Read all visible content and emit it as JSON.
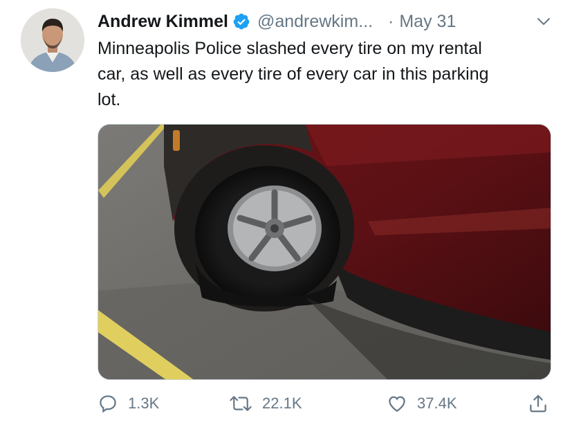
{
  "tweet": {
    "author": {
      "name": "Andrew Kimmel",
      "handle": "@andrewkim...",
      "verified": true,
      "avatar_icon": "profile-photo"
    },
    "separator": "·",
    "date": "May 31",
    "text_lines": [
      "Minneapolis Police slashed every tire on my rental",
      "car, as well as every tire of every car in this parking",
      "lot."
    ],
    "media": {
      "description_icon": "video-thumbnail"
    },
    "actions": {
      "replies": "1.3K",
      "retweets": "22.1K",
      "likes": "37.4K"
    }
  },
  "colors": {
    "text": "#14171a",
    "secondary": "#657786",
    "verified_blue": "#1da1f2"
  }
}
